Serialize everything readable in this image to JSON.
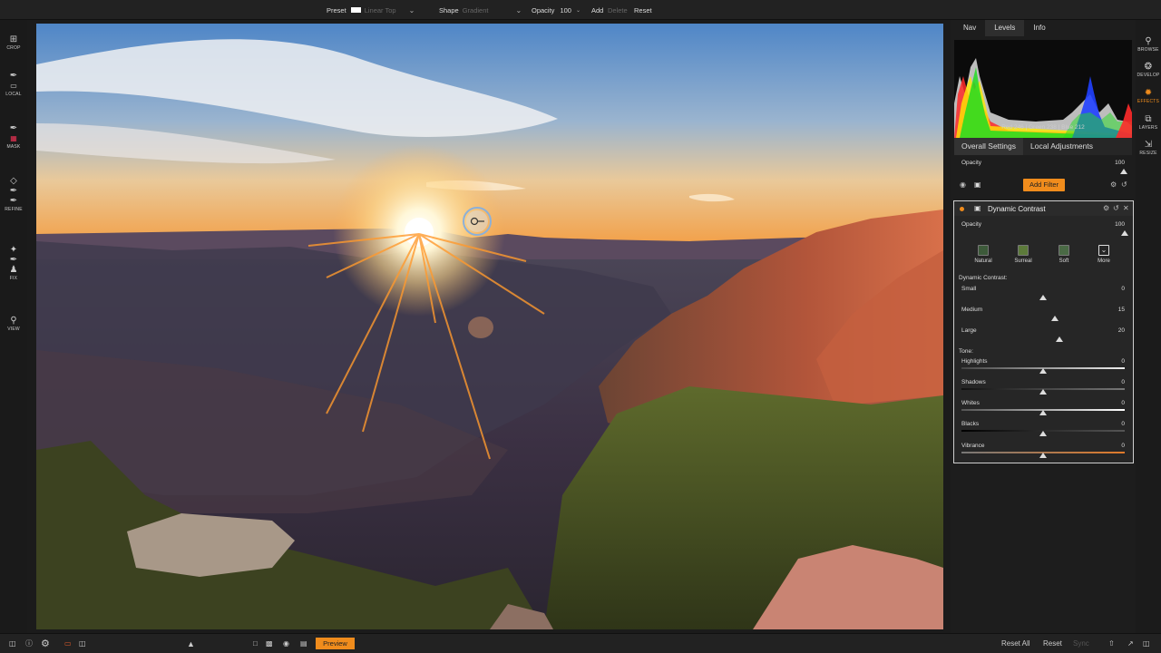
{
  "topbar": {
    "preset_label": "Preset",
    "preset_value": "Linear Top",
    "shape_label": "Shape",
    "shape_value": "Gradient",
    "opacity_label": "Opacity",
    "opacity_value": "100",
    "add": "Add",
    "delete": "Delete",
    "reset": "Reset"
  },
  "left_tools": [
    {
      "label": "CROP",
      "icon": "crop-icon"
    },
    {
      "label": "LOCAL",
      "icon": "local-brush-icon"
    },
    {
      "label": "MASK",
      "icon": "mask-brush-icon"
    },
    {
      "label": "REFINE",
      "icon": "refine-brush-icon"
    },
    {
      "label": "FIX",
      "icon": "clone-stamp-icon"
    },
    {
      "label": "VIEW",
      "icon": "zoom-icon"
    }
  ],
  "right_icons": [
    {
      "label": "BROWSE",
      "icon": "browse-icon"
    },
    {
      "label": "DEVELOP",
      "icon": "develop-aperture-icon"
    },
    {
      "label": "EFFECTS",
      "icon": "effects-icon",
      "active": true
    },
    {
      "label": "LAYERS",
      "icon": "layers-icon"
    },
    {
      "label": "RESIZE",
      "icon": "resize-icon"
    }
  ],
  "panel": {
    "tabs": [
      "Nav",
      "Levels",
      "Info"
    ],
    "active_tab": "Levels",
    "rgb_readout": "Red 246 | Green 238 | Blue 212",
    "sub_tabs": [
      "Overall Settings",
      "Local Adjustments"
    ],
    "opacity_label": "Opacity",
    "opacity_value": "100",
    "add_filter": "Add Filter"
  },
  "filter": {
    "title": "Dynamic Contrast",
    "opacity_label": "Opacity",
    "opacity_value": "100",
    "presets": [
      "Natural",
      "Surreal",
      "Soft",
      "More"
    ],
    "dc_section": "Dynamic Contrast:",
    "tone_section": "Tone:",
    "sliders": {
      "small": {
        "label": "Small",
        "value": "0"
      },
      "medium": {
        "label": "Medium",
        "value": "15"
      },
      "large": {
        "label": "Large",
        "value": "20"
      },
      "highlights": {
        "label": "Highlights",
        "value": "0"
      },
      "shadows": {
        "label": "Shadows",
        "value": "0"
      },
      "whites": {
        "label": "Whites",
        "value": "0"
      },
      "blacks": {
        "label": "Blacks",
        "value": "0"
      },
      "vibrance": {
        "label": "Vibrance",
        "value": "0"
      }
    }
  },
  "bottombar": {
    "preview": "Preview",
    "reset_all": "Reset All",
    "reset": "Reset",
    "sync": "Sync"
  },
  "colors": {
    "accent": "#f08c1c",
    "panel_bg": "#1d1d1d"
  }
}
